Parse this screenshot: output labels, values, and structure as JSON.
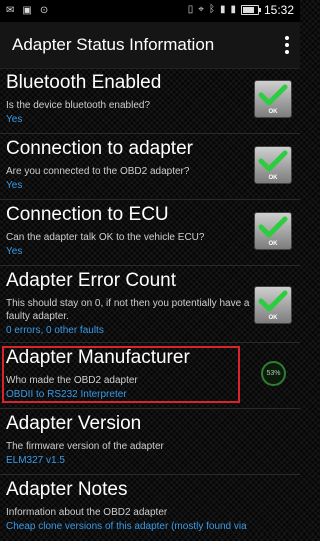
{
  "status_bar": {
    "time": "15:32",
    "battery_level_percent": 80
  },
  "app_bar": {
    "title": "Adapter Status Information"
  },
  "items": [
    {
      "title": "Bluetooth Enabled",
      "description": "Is the device bluetooth enabled?",
      "value": "Yes",
      "status": "OK"
    },
    {
      "title": "Connection to adapter",
      "description": "Are you connected to the OBD2 adapter?",
      "value": "Yes",
      "status": "OK"
    },
    {
      "title": "Connection to ECU",
      "description": "Can the adapter talk OK to the vehicle ECU?",
      "value": "Yes",
      "status": "OK"
    },
    {
      "title": "Adapter Error Count",
      "description": "This should stay on 0, if not then you potentially have a faulty adapter.",
      "value": "0 errors, 0 other faults",
      "status": "OK"
    },
    {
      "title": "Adapter Manufacturer",
      "description": "Who made the OBD2 adapter",
      "value": "OBDII to RS232 Interpreter"
    },
    {
      "title": "Adapter Version",
      "description": "The firmware version of the adapter",
      "value": "ELM327 v1.5",
      "progress": "53%"
    },
    {
      "title": "Adapter Notes",
      "description": "Information about the OBD2 adapter",
      "value": "Cheap clone versions of this adapter (mostly found via"
    }
  ],
  "colors": {
    "value_text": "#3a9be8",
    "highlight_border": "#d8242c",
    "ok_check": "#2ecc40"
  }
}
